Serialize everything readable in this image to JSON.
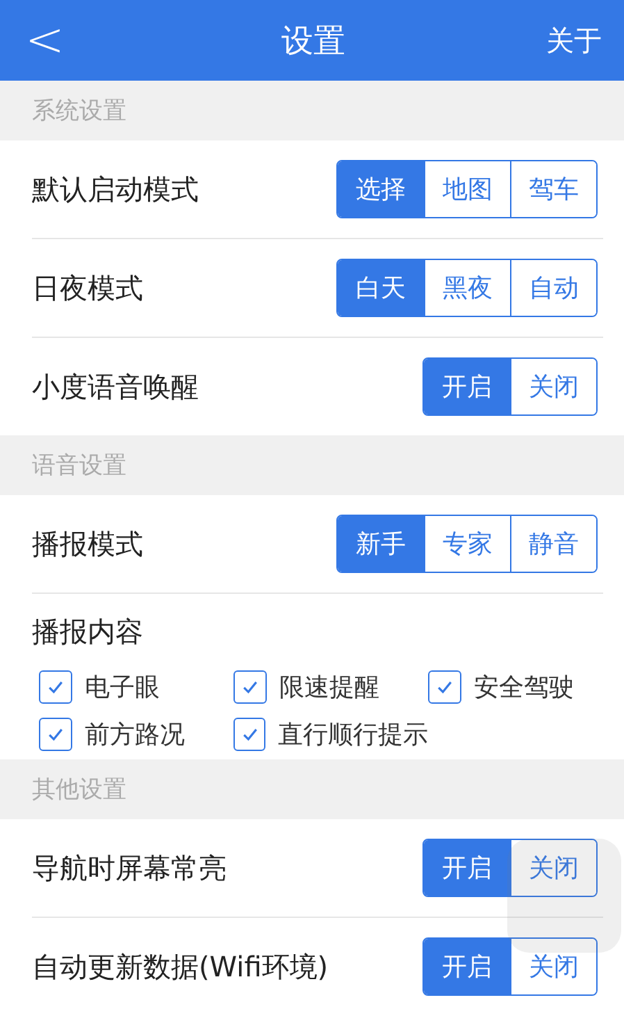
{
  "header": {
    "back": "<",
    "title": "设置",
    "action": "关于"
  },
  "sections": [
    {
      "title": "系统设置",
      "items": [
        {
          "kind": "segmented",
          "label": "默认启动模式",
          "options": [
            {
              "label": "选择",
              "selected": true
            },
            {
              "label": "地图",
              "selected": false
            },
            {
              "label": "驾车",
              "selected": false
            }
          ]
        },
        {
          "kind": "segmented",
          "label": "日夜模式",
          "options": [
            {
              "label": "白天",
              "selected": true
            },
            {
              "label": "黑夜",
              "selected": false
            },
            {
              "label": "自动",
              "selected": false
            }
          ]
        },
        {
          "kind": "segmented",
          "label": "小度语音唤醒",
          "options": [
            {
              "label": "开启",
              "selected": true
            },
            {
              "label": "关闭",
              "selected": false
            }
          ]
        }
      ]
    },
    {
      "title": "语音设置",
      "items": [
        {
          "kind": "segmented",
          "label": "播报模式",
          "options": [
            {
              "label": "新手",
              "selected": true
            },
            {
              "label": "专家",
              "selected": false
            },
            {
              "label": "静音",
              "selected": false
            }
          ]
        },
        {
          "kind": "checkboxes",
          "label": "播报内容",
          "options": [
            {
              "label": "电子眼",
              "checked": true
            },
            {
              "label": "限速提醒",
              "checked": true
            },
            {
              "label": "安全驾驶",
              "checked": true
            },
            {
              "label": "前方路况",
              "checked": true
            },
            {
              "label": "直行顺行提示",
              "checked": true
            }
          ]
        }
      ]
    },
    {
      "title": "其他设置",
      "items": [
        {
          "kind": "segmented",
          "label": "导航时屏幕常亮",
          "options": [
            {
              "label": "开启",
              "selected": true
            },
            {
              "label": "关闭",
              "selected": false
            }
          ]
        },
        {
          "kind": "segmented",
          "label": "自动更新数据(Wifi环境)",
          "options": [
            {
              "label": "开启",
              "selected": true
            },
            {
              "label": "关闭",
              "selected": false
            }
          ]
        }
      ]
    }
  ]
}
